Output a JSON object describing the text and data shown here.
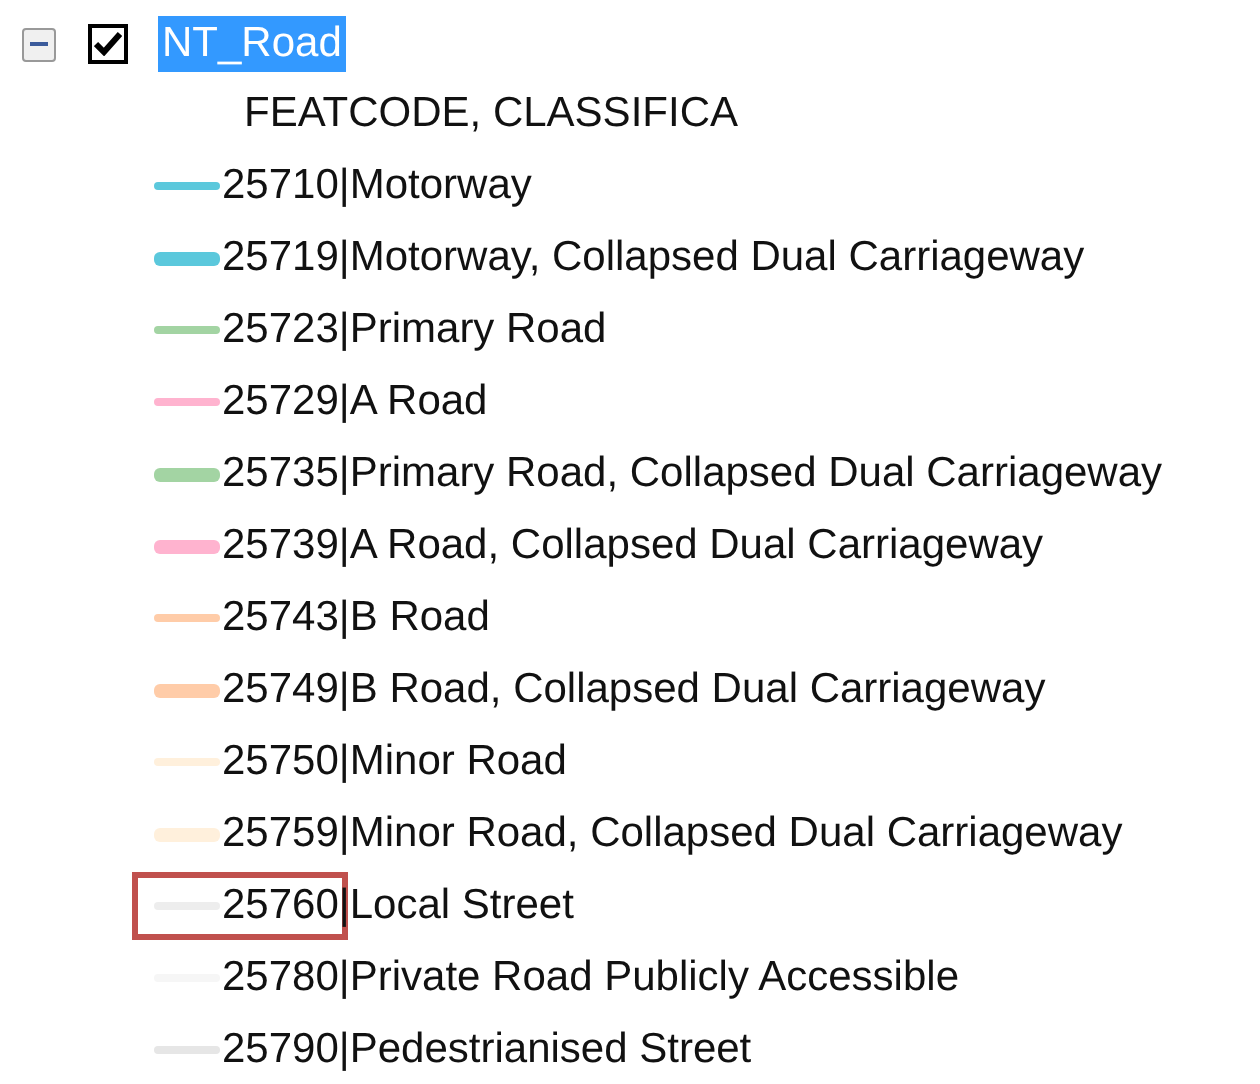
{
  "layer": {
    "name": "NT_Road",
    "expanded": true,
    "checked": true,
    "selected": true
  },
  "field_label": "FEATCODE, CLASSIFICA",
  "classes": [
    {
      "label": "25710|Motorway",
      "kind": "thin",
      "color": "#5bc8dc",
      "highlighted": false
    },
    {
      "label": "25719|Motorway, Collapsed Dual Carriageway",
      "kind": "thick",
      "color": "#5bc8dc",
      "highlighted": false
    },
    {
      "label": "25723|Primary Road",
      "kind": "thin",
      "color": "#a3d4a3",
      "highlighted": false
    },
    {
      "label": "25729|A Road",
      "kind": "thin",
      "color": "#ffb3cf",
      "highlighted": false
    },
    {
      "label": "25735|Primary Road, Collapsed Dual Carriageway",
      "kind": "thick",
      "color": "#a3d4a3",
      "highlighted": false
    },
    {
      "label": "25739|A Road, Collapsed Dual Carriageway",
      "kind": "thick",
      "color": "#ffb3cf",
      "highlighted": false
    },
    {
      "label": "25743|B Road",
      "kind": "thin",
      "color": "#ffcca8",
      "highlighted": false
    },
    {
      "label": "25749|B Road, Collapsed Dual Carriageway",
      "kind": "thick",
      "color": "#ffcca8",
      "highlighted": false
    },
    {
      "label": "25750|Minor Road",
      "kind": "thin",
      "color": "#fff0dc",
      "highlighted": false
    },
    {
      "label": "25759|Minor Road, Collapsed Dual Carriageway",
      "kind": "thick",
      "color": "#fff0dc",
      "highlighted": false
    },
    {
      "label": "25760|Local Street",
      "kind": "thin",
      "color": "#ededed",
      "highlighted": true
    },
    {
      "label": "25780|Private Road Publicly Accessible",
      "kind": "thin",
      "color": "#f6f6f6",
      "highlighted": false
    },
    {
      "label": "25790|Pedestrianised Street",
      "kind": "thin",
      "color": "#e6e6e6",
      "highlighted": false
    }
  ]
}
